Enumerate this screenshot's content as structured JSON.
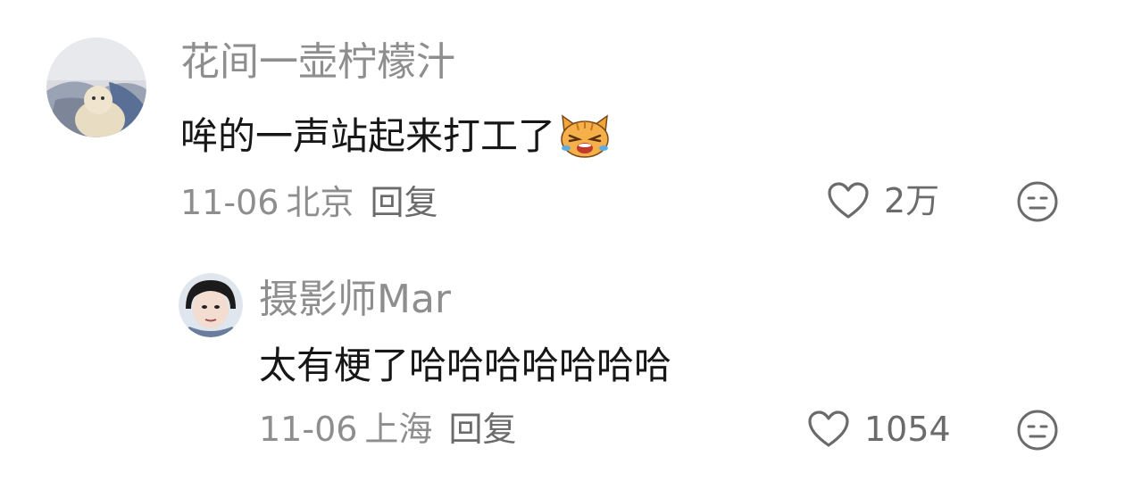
{
  "comments": [
    {
      "username": "花间一壶柠檬汁",
      "content": "哞的一声站起来打工了",
      "emoji_icon": "crying-cat-emoji",
      "date": "11-06",
      "location": "北京",
      "reply_label": "回复",
      "like_count": "2万",
      "replies": [
        {
          "username": "摄影师Mar",
          "content": "太有梗了哈哈哈哈哈哈哈",
          "date": "11-06",
          "location": "上海",
          "reply_label": "回复",
          "like_count": "1054"
        }
      ]
    }
  ],
  "icons": {
    "like": "heart-outline-icon",
    "dislike": "unamused-face-icon"
  },
  "colors": {
    "username": "#8e8e8e",
    "content": "#161616",
    "meta": "#8e8e8e",
    "icon": "#6b6b6b"
  }
}
